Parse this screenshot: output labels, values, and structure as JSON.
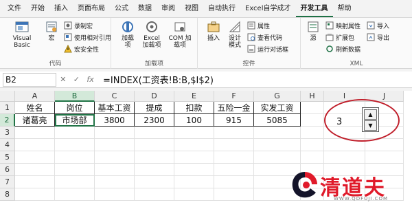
{
  "tabs": [
    {
      "label": "文件"
    },
    {
      "label": "开始"
    },
    {
      "label": "插入"
    },
    {
      "label": "页面布局"
    },
    {
      "label": "公式"
    },
    {
      "label": "数据"
    },
    {
      "label": "审阅"
    },
    {
      "label": "视图"
    },
    {
      "label": "自动执行"
    },
    {
      "label": "Excel自学成才"
    },
    {
      "label": "开发工具",
      "active": true
    },
    {
      "label": "帮助"
    }
  ],
  "ribbon": {
    "code": {
      "label": "代码",
      "visual_basic": "Visual Basic",
      "macros": "宏",
      "record_macro": "录制宏",
      "relative_refs": "使用相对引用",
      "macro_security": "宏安全性"
    },
    "addins": {
      "label": "加载项",
      "addins_btn": "加载项",
      "excel_addins": "Excel加载项",
      "com_addins": "COM 加载项"
    },
    "controls": {
      "label": "控件",
      "insert": "插入",
      "design_mode": "设计模式",
      "properties": "属性",
      "view_code": "查看代码",
      "run_dialog": "运行对话框"
    },
    "xml": {
      "label": "XML",
      "source": "源",
      "map_props": "映射属性",
      "expansion_packs": "扩展包",
      "refresh_data": "刷新数据",
      "import": "导入",
      "export": "导出"
    }
  },
  "formula_bar": {
    "name_box": "B2",
    "cancel": "✕",
    "enter": "✓",
    "fx": "fx",
    "formula": "=INDEX(工资表!B:B,$I$2)"
  },
  "sheet": {
    "columns": [
      "A",
      "B",
      "C",
      "D",
      "E",
      "F",
      "G",
      "H",
      "I",
      "J"
    ],
    "rows": [
      "1",
      "2",
      "3",
      "4",
      "5",
      "6",
      "7",
      "8"
    ],
    "header_row": [
      "姓名",
      "岗位",
      "基本工资",
      "提成",
      "扣款",
      "五险一金",
      "实发工资"
    ],
    "data_row": [
      "诸葛亮",
      "市场部",
      "3800",
      "2300",
      "100",
      "915",
      "5085"
    ],
    "spinner_value": "3",
    "spinner_up": "▲",
    "spinner_down": "▼"
  },
  "watermark": {
    "brand": "清道夫",
    "url": "WWW.QDFUJI.COM"
  },
  "colors": {
    "accent": "#217346",
    "highlight_circle": "#c0202c",
    "brand_red": "#e01a2a"
  }
}
